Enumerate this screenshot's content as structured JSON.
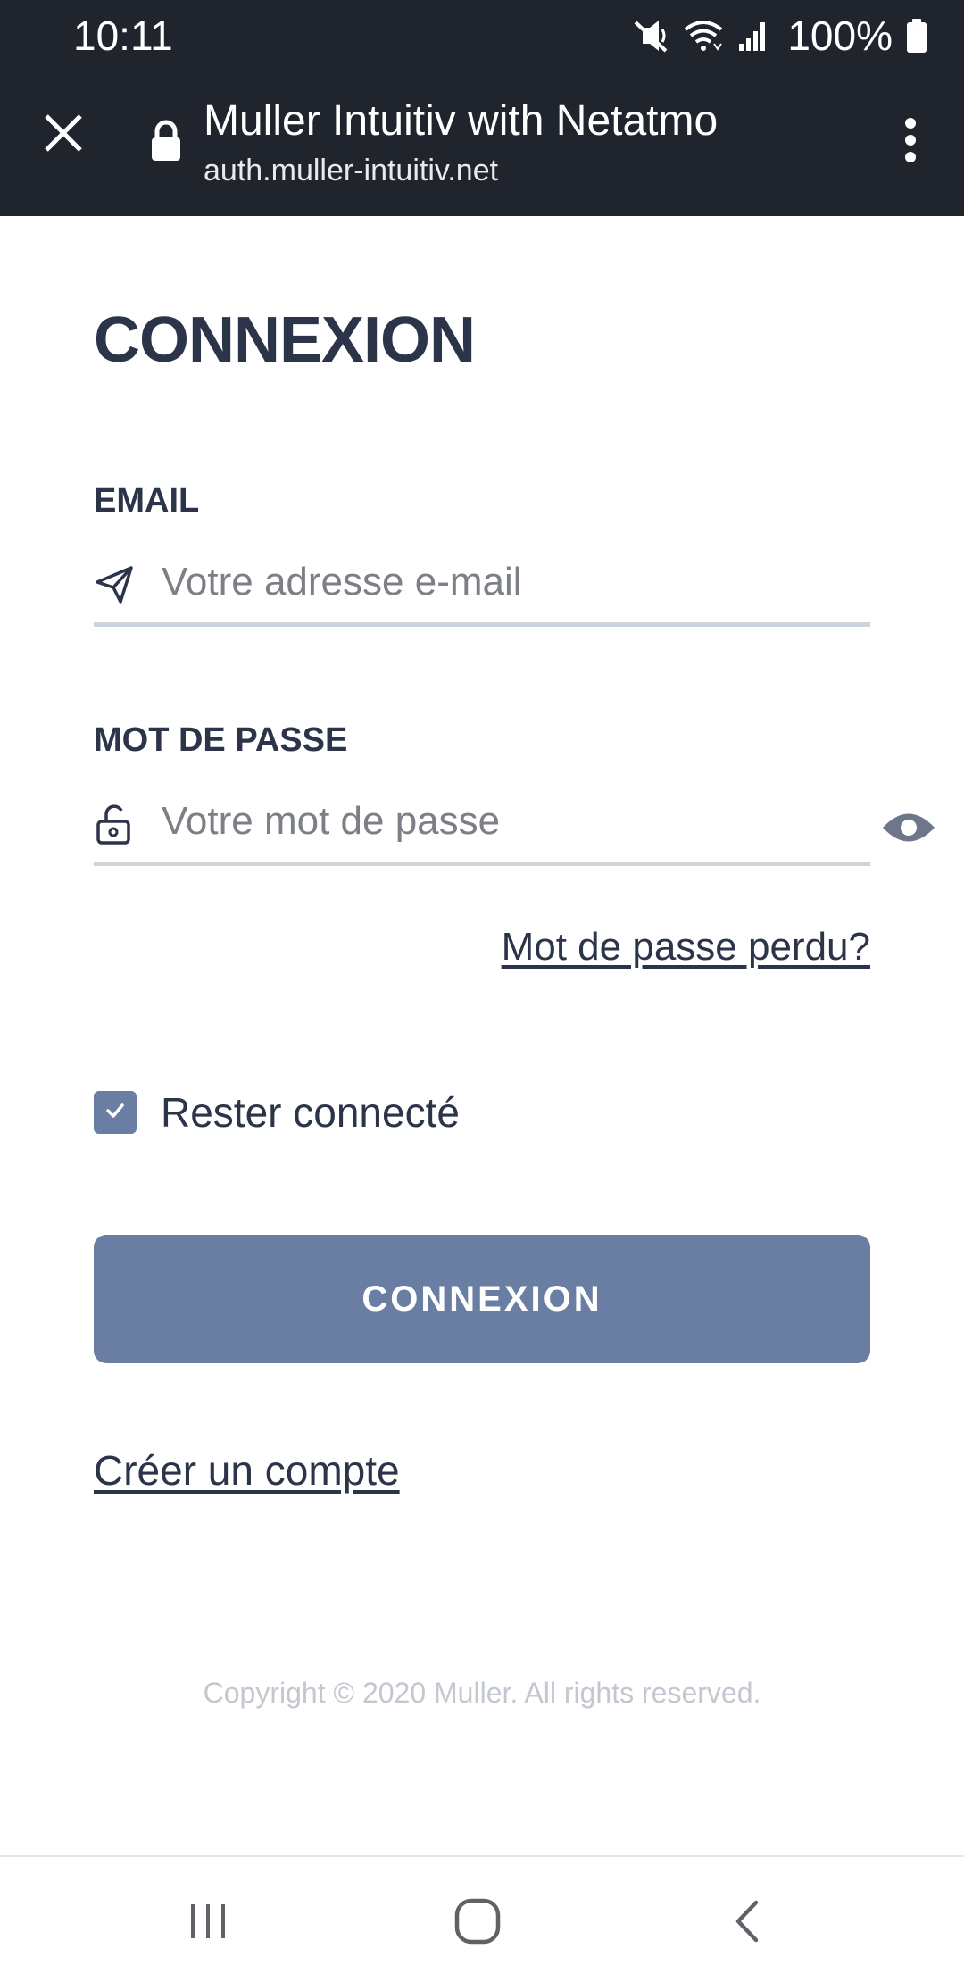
{
  "status_bar": {
    "time": "10:11",
    "battery": "100%",
    "icons": [
      "mute-icon",
      "wifi-icon",
      "signal-icon",
      "battery-icon"
    ]
  },
  "browser": {
    "title": "Muller Intuitiv with Netatmo",
    "url": "auth.muller-intuitiv.net",
    "icons": [
      "close-icon",
      "lock-icon",
      "more-vert-icon"
    ]
  },
  "login": {
    "heading": "CONNEXION",
    "email": {
      "label": "EMAIL",
      "placeholder": "Votre adresse e-mail",
      "value": "",
      "icon": "send-icon"
    },
    "password": {
      "label": "MOT DE PASSE",
      "placeholder": "Votre mot de passe",
      "value": "",
      "icon": "unlock-icon",
      "toggle_icon": "eye-icon"
    },
    "forgot_link": "Mot de passe perdu?",
    "remember": {
      "label": "Rester connecté",
      "checked": true
    },
    "submit_label": "CONNEXION",
    "create_account_link": "Créer un compte",
    "copyright": "Copyright © 2020 Muller. All rights reserved."
  },
  "nav_bar": {
    "icons": [
      "recents-icon",
      "home-icon",
      "back-icon"
    ]
  },
  "colors": {
    "chrome_bg": "#20242c",
    "primary": "#6a7ea3",
    "text_dark": "#2b3448",
    "underline": "#cdd3dc",
    "copyright": "#c3c7cf"
  }
}
